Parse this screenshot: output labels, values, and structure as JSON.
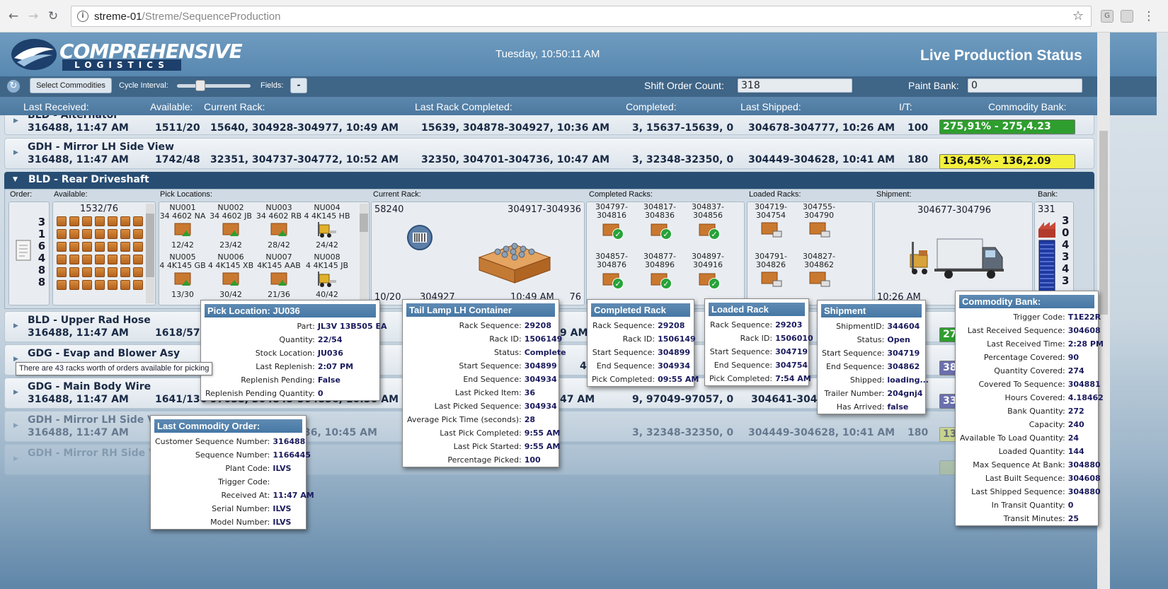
{
  "browser": {
    "url_host": "streme-01",
    "url_path": "/Streme/SequenceProduction",
    "ext1": "G"
  },
  "header": {
    "brand": "COMPREHENSIVE",
    "brand_sub": "LOGISTICS",
    "clock": "Tuesday, 10:50:11 AM",
    "title": "Live Production Status"
  },
  "toolbar": {
    "select_label": "Select Commodities",
    "cycle_label": "Cycle Interval:",
    "fields_label": "Fields:",
    "fields_btn": "-",
    "shift_label": "Shift Order Count:",
    "shift_value": "318",
    "paint_label": "Paint Bank:",
    "paint_value": "0"
  },
  "columns": {
    "last_received": "Last Received:",
    "available": "Available:",
    "current_rack": "Current Rack:",
    "last_rack": "Last Rack Completed:",
    "completed": "Completed:",
    "last_shipped": "Last Shipped:",
    "it": "I/T:",
    "bank": "Commodity Bank:"
  },
  "rows": [
    {
      "name": "BLD - Alternator",
      "received": "316488, 11:47 AM",
      "available": "1511/20",
      "current": "15640, 304928-304977, 10:49 AM",
      "last_rack": "15639, 304878-304927, 10:36 AM",
      "completed": "3, 15637-15639, 0",
      "shipped": "304678-304777, 10:26 AM",
      "it": "100",
      "bank": "275,91% - 275,4.23",
      "bank_color": "green"
    },
    {
      "name": "GDH - Mirror LH Side View",
      "received": "316488, 11:47 AM",
      "available": "1742/48",
      "current": "32351, 304737-304772, 10:52 AM",
      "last_rack": "32350, 304701-304736, 10:47 AM",
      "completed": "3, 32348-32350, 0",
      "shipped": "304449-304628, 10:41 AM",
      "it": "180",
      "bank": "136,45% - 136,2.09",
      "bank_color": "yellow"
    },
    {
      "name": "BLD - Upper Rad Hose",
      "received": "316488, 11:47 AM",
      "available": "1618/57",
      "current": "",
      "last_rack": "9 AM",
      "completed": "",
      "shipped": "",
      "it": "",
      "bank": "27",
      "bank_color": "green"
    },
    {
      "name": "GDG - Evap and Blower Asy",
      "received": "",
      "available": "",
      "current": "",
      "last_rack": "48 AM",
      "completed": "",
      "shipped": "",
      "it": "",
      "bank": "38",
      "bank_color": "purple"
    },
    {
      "name": "GDG - Main Body Wire",
      "received": "316488, 11:47 AM",
      "available": "1641/136",
      "current": "97058, 304845-304856, 10:50 AM",
      "last_rack": "47 AM",
      "completed": "9, 97049-97057, 0",
      "shipped": "304641-30473",
      "it": "",
      "bank": "33",
      "bank_color": "purple"
    },
    {
      "name": "GDH - Mirror LH Side Vi",
      "received": "316488, 11:47 AM",
      "available": "",
      "current": "36, 10:45 AM",
      "last_rack": "",
      "completed": "3, 32348-32350, 0",
      "shipped": "304449-304628, 10:41 AM",
      "it": "180",
      "bank": "13",
      "bank_color": "yellow"
    },
    {
      "name": "GDH - Mirror RH Side Vi",
      "received": "",
      "available": "",
      "current": "",
      "last_rack": "",
      "completed": "",
      "shipped": "",
      "it": "",
      "bank": "",
      "bank_color": "yellow"
    }
  ],
  "expanded": {
    "name": "BLD - Rear Driveshaft",
    "labels": {
      "order": "Order:",
      "available": "Available:",
      "pick": "Pick Locations:",
      "current": "Current Rack:",
      "completed": "Completed Racks:",
      "loaded": "Loaded Racks:",
      "shipment": "Shipment:",
      "bank": "Bank:"
    },
    "order_digits": [
      "3",
      "1",
      "6",
      "4",
      "8",
      "8"
    ],
    "available": "1532/76",
    "pick_locations": [
      {
        "code": "NU001",
        "part": "34 4602 NA",
        "qty": "12/42"
      },
      {
        "code": "NU002",
        "part": "34 4602 JB",
        "qty": "23/42"
      },
      {
        "code": "NU003",
        "part": "34 4602 RB",
        "qty": "28/42"
      },
      {
        "code": "NU004",
        "part": "4 4K145 HB",
        "qty": "24/42"
      },
      {
        "code": "NU005",
        "part": "4 4K145 GB",
        "qty": "13/30"
      },
      {
        "code": "NU006",
        "part": "4 4K145 XB",
        "qty": "30/42"
      },
      {
        "code": "NU007",
        "part": "4K145 AAB",
        "qty": "21/36"
      },
      {
        "code": "NU008",
        "part": "4 4K145 JB",
        "qty": "40/42"
      }
    ],
    "current_rack": {
      "id": "58240",
      "range": "304917-304936",
      "count": "10/20",
      "seq": "304927",
      "time": "10:49 AM",
      "total": "76"
    },
    "completed_racks": [
      "304797-\n304816",
      "304817-\n304836",
      "304837-\n304856",
      "304857-\n304876",
      "304877-\n304896",
      "304897-\n304916"
    ],
    "loaded_racks": [
      "304719-\n304754",
      "304755-\n304790",
      "304791-\n304826",
      "304827-\n304862"
    ],
    "shipment": {
      "range": "304677-304796",
      "time": "10:26 AM"
    },
    "bank": {
      "count": "331",
      "digits": [
        "3",
        "0",
        "4",
        "3",
        "4",
        "3"
      ]
    }
  },
  "tooltips": {
    "pick": {
      "title": "Pick Location: JU036",
      "rows": [
        [
          "Part:",
          "JL3V 13B505 EA"
        ],
        [
          "Quantity:",
          "22/54"
        ],
        [
          "Stock Location:",
          "JU036"
        ],
        [
          "Last Replenish:",
          "2:07 PM"
        ],
        [
          "Replenish Pending:",
          "False"
        ],
        [
          "Replenish Pending Quantity:",
          "0"
        ]
      ]
    },
    "hint": "There are 43 racks worth of orders available for picking",
    "tail": {
      "title": "Tail Lamp LH Container",
      "rows": [
        [
          "Rack Sequence:",
          "29208"
        ],
        [
          "Rack ID:",
          "1506149"
        ],
        [
          "Status:",
          "Complete"
        ],
        [
          "Start Sequence:",
          "304899"
        ],
        [
          "End Sequence:",
          "304934"
        ],
        [
          "Last Picked Item:",
          "36"
        ],
        [
          "Last Picked Sequence:",
          "304934"
        ],
        [
          "Average Pick Time (seconds):",
          "28"
        ],
        [
          "Last Pick Completed:",
          "9:55 AM"
        ],
        [
          "Last Pick Started:",
          "9:55 AM"
        ],
        [
          "Percentage Picked:",
          "100"
        ]
      ]
    },
    "completed": {
      "title": "Completed Rack",
      "rows": [
        [
          "Rack Sequence:",
          "29208"
        ],
        [
          "Rack ID:",
          "1506149"
        ],
        [
          "Start Sequence:",
          "304899"
        ],
        [
          "End Sequence:",
          "304934"
        ],
        [
          "Pick Completed:",
          "09:55 AM"
        ]
      ]
    },
    "loaded": {
      "title": "Loaded Rack",
      "rows": [
        [
          "Rack Sequence:",
          "29203"
        ],
        [
          "Rack ID:",
          "1506010"
        ],
        [
          "Start Sequence:",
          "304719"
        ],
        [
          "End Sequence:",
          "304754"
        ],
        [
          "Pick Completed:",
          "7:54 AM"
        ]
      ]
    },
    "shipment": {
      "title": "Shipment",
      "rows": [
        [
          "ShipmentID:",
          "344604"
        ],
        [
          "Status:",
          "Open"
        ],
        [
          "Start Sequence:",
          "304719"
        ],
        [
          "End Sequence:",
          "304862"
        ],
        [
          "Shipped:",
          "loading..."
        ],
        [
          "Trailer Number:",
          "204gnj4"
        ],
        [
          "Has Arrived:",
          "false"
        ]
      ]
    },
    "order": {
      "title": "Last Commodity Order:",
      "rows": [
        [
          "Customer Sequence Number:",
          "316488"
        ],
        [
          "Sequence Number:",
          "1166445"
        ],
        [
          "Plant Code:",
          "ILVS"
        ],
        [
          "Trigger Code:",
          ""
        ],
        [
          "Received At:",
          "11:47 AM"
        ],
        [
          "Serial Number:",
          "ILVS"
        ],
        [
          "Model Number:",
          "ILVS"
        ]
      ]
    },
    "bank": {
      "title": "Commodity Bank:",
      "rows": [
        [
          "Trigger Code:",
          "T1E22R"
        ],
        [
          "Last Received Sequence:",
          "304608"
        ],
        [
          "Last Received Time:",
          "2:28 PM"
        ],
        [
          "Percentage Covered:",
          "90"
        ],
        [
          "Quantity Covered:",
          "274"
        ],
        [
          "Covered To Sequence:",
          "304881"
        ],
        [
          "Hours Covered:",
          "4.18462"
        ],
        [
          "Bank Quantity:",
          "272"
        ],
        [
          "Capacity:",
          "240"
        ],
        [
          "Available To Load Quantity:",
          "24"
        ],
        [
          "Loaded Quantity:",
          "144"
        ],
        [
          "Max Sequence At Bank:",
          "304880"
        ],
        [
          "Last Built Sequence:",
          "304608"
        ],
        [
          "Last Shipped Sequence:",
          "304880"
        ],
        [
          "In Transit Quantity:",
          "0"
        ],
        [
          "Transit Minutes:",
          "25"
        ]
      ]
    }
  }
}
